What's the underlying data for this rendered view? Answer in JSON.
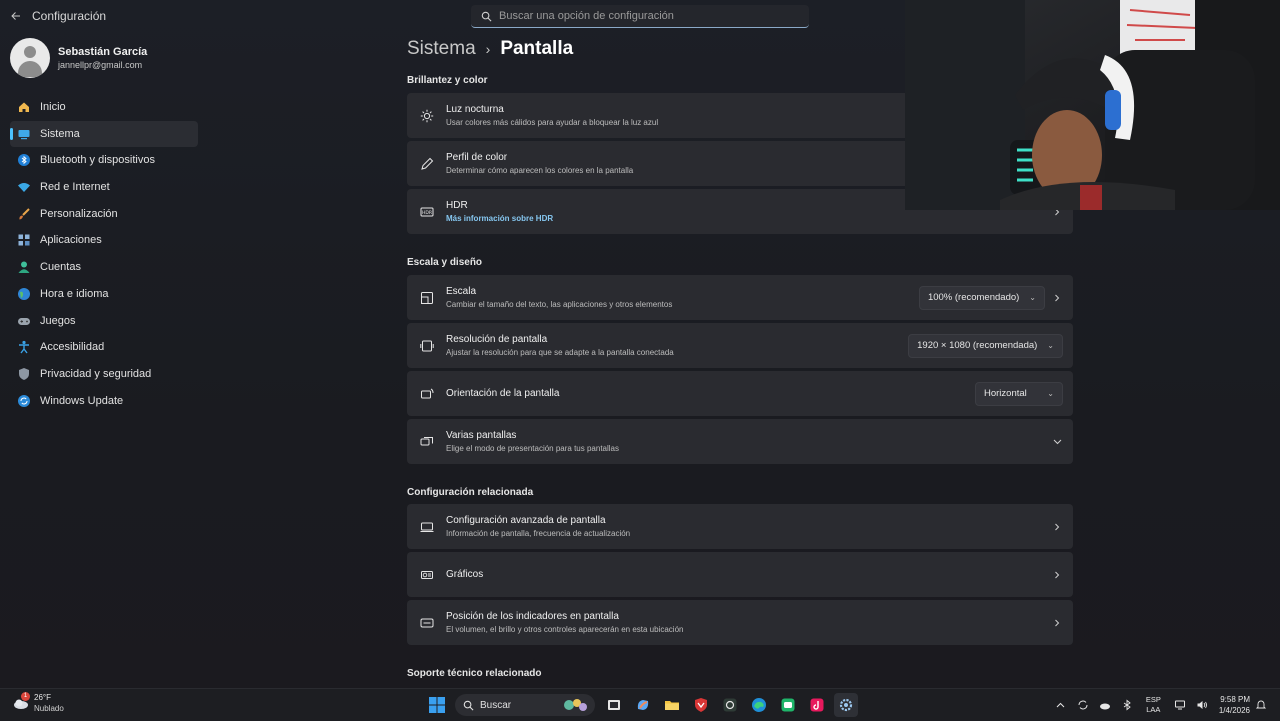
{
  "window": {
    "title": "Configuración"
  },
  "search": {
    "placeholder": "Buscar una opción de configuración"
  },
  "profile": {
    "name": "Sebastián García",
    "email": "jannellpr@gmail.com"
  },
  "nav": {
    "items": [
      {
        "label": "Inicio",
        "icon": "home-icon"
      },
      {
        "label": "Sistema",
        "icon": "system-icon",
        "active": true
      },
      {
        "label": "Bluetooth y dispositivos",
        "icon": "bluetooth-icon"
      },
      {
        "label": "Red e Internet",
        "icon": "wifi-icon"
      },
      {
        "label": "Personalización",
        "icon": "brush-icon"
      },
      {
        "label": "Aplicaciones",
        "icon": "apps-icon"
      },
      {
        "label": "Cuentas",
        "icon": "accounts-icon"
      },
      {
        "label": "Hora e idioma",
        "icon": "globe-icon"
      },
      {
        "label": "Juegos",
        "icon": "gamepad-icon"
      },
      {
        "label": "Accesibilidad",
        "icon": "accessibility-icon"
      },
      {
        "label": "Privacidad y seguridad",
        "icon": "shield-icon"
      },
      {
        "label": "Windows Update",
        "icon": "update-icon"
      }
    ]
  },
  "breadcrumb": {
    "parent": "Sistema",
    "current": "Pantalla"
  },
  "sections": {
    "brightness": {
      "title": "Brillantez y color",
      "cards": [
        {
          "title": "Luz nocturna",
          "subtitle": "Usar colores más cálidos para ayudar a bloquear la luz azul"
        },
        {
          "title": "Perfil de color",
          "subtitle": "Determinar cómo aparecen los colores en la pantalla"
        },
        {
          "title": "HDR",
          "subtitle": "Más información sobre HDR"
        }
      ]
    },
    "scale": {
      "title": "Escala y diseño",
      "cards": [
        {
          "title": "Escala",
          "subtitle": "Cambiar el tamaño del texto, las aplicaciones y otros elementos",
          "value": "100% (recomendado)"
        },
        {
          "title": "Resolución de pantalla",
          "subtitle": "Ajustar la resolución para que se adapte a la pantalla conectada",
          "value": "1920 × 1080 (recomendada)"
        },
        {
          "title": "Orientación de la pantalla",
          "value": "Horizontal"
        },
        {
          "title": "Varias pantallas",
          "subtitle": "Elige el modo de presentación para tus pantallas"
        }
      ]
    },
    "related": {
      "title": "Configuración relacionada",
      "cards": [
        {
          "title": "Configuración avanzada de pantalla",
          "subtitle": "Información de pantalla, frecuencia de actualización"
        },
        {
          "title": "Gráficos"
        },
        {
          "title": "Posición de los indicadores en pantalla",
          "subtitle": "El volumen, el brillo y otros controles aparecerán en esta ubicación"
        }
      ]
    },
    "support": {
      "title": "Soporte técnico relacionado"
    }
  },
  "taskbar": {
    "weather": {
      "temp": "26°F",
      "desc": "Nublado",
      "badge": "1"
    },
    "search_label": "Buscar",
    "lang": {
      "line1": "ESP",
      "line2": "LAA"
    },
    "clock": {
      "time": "9:58 PM",
      "date": "1/4/2026"
    }
  },
  "colors": {
    "accent": "#4cc2ff",
    "link": "#86c7f0",
    "card": "#2a2b30"
  }
}
